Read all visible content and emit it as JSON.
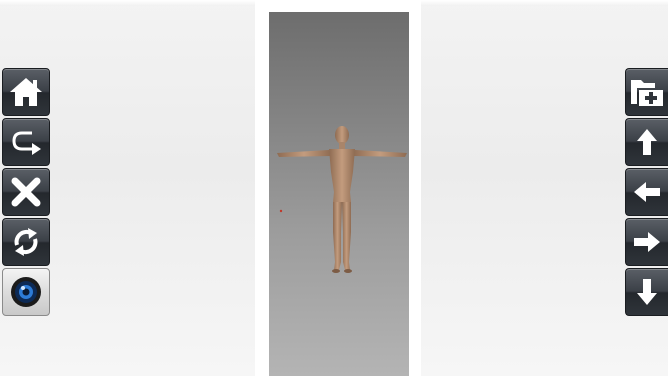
{
  "app": {
    "left_toolbar": [
      {
        "id": "home",
        "icon": "home-icon"
      },
      {
        "id": "redo",
        "icon": "redo-arrow-icon"
      },
      {
        "id": "close",
        "icon": "close-x-icon"
      },
      {
        "id": "refresh",
        "icon": "refresh-icon"
      },
      {
        "id": "camera",
        "icon": "camera-lens-icon"
      }
    ],
    "right_toolbar": [
      {
        "id": "add-folder",
        "icon": "folder-plus-icon"
      },
      {
        "id": "move-up",
        "icon": "arrow-up-icon"
      },
      {
        "id": "move-left",
        "icon": "arrow-left-icon"
      },
      {
        "id": "move-right",
        "icon": "arrow-right-icon"
      },
      {
        "id": "move-down",
        "icon": "arrow-down-icon"
      }
    ],
    "viewport": {
      "model": "3d-human-figure-t-pose"
    }
  },
  "colors": {
    "button_dark": "#2f343a",
    "icon_white": "#ffffff",
    "skin": "#b08a6e",
    "viewport_top": "#6d6d6d",
    "viewport_bottom": "#b4b4b4"
  }
}
